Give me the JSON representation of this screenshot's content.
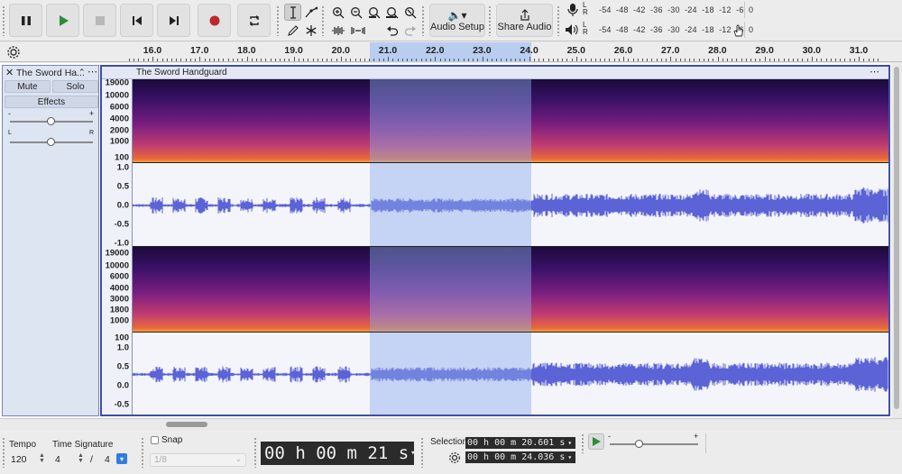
{
  "toolbar": {
    "audio_setup_label": "Audio Setup",
    "share_audio_label": "Share Audio",
    "meter_scale": [
      "-54",
      "-48",
      "-42",
      "-36",
      "-30",
      "-24",
      "-18",
      "-12",
      "-6",
      "0"
    ],
    "meter_channels": [
      "L",
      "R"
    ]
  },
  "ruler": {
    "ticks": [
      "16.0",
      "17.0",
      "18.0",
      "19.0",
      "20.0",
      "21.0",
      "22.0",
      "23.0",
      "24.0",
      "25.0",
      "26.0",
      "27.0",
      "28.0",
      "29.0",
      "30.0",
      "31.0"
    ]
  },
  "track": {
    "name": "The Sword Ha...",
    "clip_name": "The Sword Handguard",
    "mute_label": "Mute",
    "solo_label": "Solo",
    "effects_label": "Effects",
    "gain_min": "-",
    "gain_max": "+",
    "pan_left": "L",
    "pan_right": "R",
    "spectrogram_scale": [
      "19000",
      "10000",
      "6000",
      "4000",
      "2000",
      "1000",
      "100"
    ],
    "spectrogram_scale_2": [
      "19000",
      "10000",
      "6000",
      "4000",
      "3000",
      "1800",
      "1000",
      "100"
    ],
    "waveform_scale": [
      "1.0",
      "0.5",
      "0.0",
      "-0.5",
      "-1.0"
    ]
  },
  "bottom": {
    "tempo_label": "Tempo",
    "tempo_value": "120",
    "time_signature_label": "Time Signature",
    "ts_numerator": "4",
    "ts_slash": "/",
    "ts_denominator": "4",
    "snap_label": "Snap",
    "snap_value": "1/8",
    "time_display": "00 h 00 m 21 s",
    "selection_label": "Selection",
    "selection_start": "00 h 00 m 20.601 s",
    "selection_end": "00 h 00 m 24.036 s",
    "playback_min": "-",
    "playback_max": "+"
  },
  "colors": {
    "selection": "#b9cdf0",
    "waveform": "#5b63d6",
    "clip_border": "#3d4fa8",
    "record": "#c0272d",
    "play": "#2e8b3a"
  }
}
